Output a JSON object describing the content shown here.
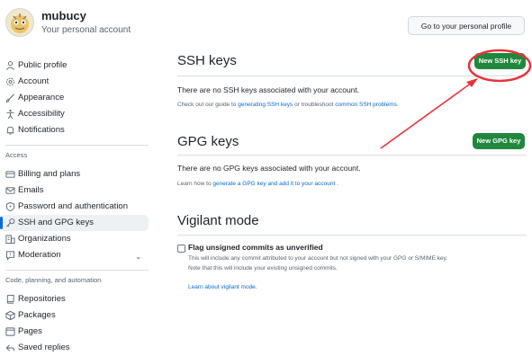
{
  "header": {
    "username": "mubucy",
    "account_label": "Your personal account",
    "profile_button": "Go to your personal profile"
  },
  "sidebar": {
    "items_top": [
      {
        "label": "Public profile",
        "icon": "person-icon"
      },
      {
        "label": "Account",
        "icon": "gear-icon"
      },
      {
        "label": "Appearance",
        "icon": "paintbrush-icon"
      },
      {
        "label": "Accessibility",
        "icon": "accessibility-icon"
      },
      {
        "label": "Notifications",
        "icon": "bell-icon"
      }
    ],
    "access_heading": "Access",
    "items_access": [
      {
        "label": "Billing and plans",
        "icon": "credit-card-icon"
      },
      {
        "label": "Emails",
        "icon": "mail-icon"
      },
      {
        "label": "Password and authentication",
        "icon": "shield-lock-icon"
      },
      {
        "label": "SSH and GPG keys",
        "icon": "key-icon"
      },
      {
        "label": "Organizations",
        "icon": "organization-icon"
      },
      {
        "label": "Moderation",
        "icon": "report-icon"
      }
    ],
    "code_heading": "Code, planning, and automation",
    "items_code": [
      {
        "label": "Repositories",
        "icon": "repo-icon"
      },
      {
        "label": "Packages",
        "icon": "package-icon"
      },
      {
        "label": "Pages",
        "icon": "browser-icon"
      },
      {
        "label": "Saved replies",
        "icon": "reply-icon"
      }
    ]
  },
  "ssh": {
    "title": "SSH keys",
    "button": "New SSH key",
    "empty": "There are no SSH keys associated with your account.",
    "help_prefix": "Check out our guide to ",
    "help_link1": "generating SSH keys",
    "help_mid": " or troubleshoot ",
    "help_link2": "common SSH problems",
    "help_suffix": "."
  },
  "gpg": {
    "title": "GPG keys",
    "button": "New GPG key",
    "empty": "There are no GPG keys associated with your account.",
    "help_prefix": "Learn how to ",
    "help_link": "generate a GPG key and add it to your account",
    "help_suffix": " ."
  },
  "vigilant": {
    "title": "Vigilant mode",
    "checkbox_label": "Flag unsigned commits as unverified",
    "desc1": "This will include any commit attributed to your account but not signed with your GPG or S/MIME key.",
    "desc2": "Note that this will include your existing unsigned commits.",
    "learn_link": "Learn about vigilant mode."
  },
  "colors": {
    "accent_green": "#1f883d",
    "link_blue": "#0969da",
    "annotation_red": "#e8333a"
  }
}
